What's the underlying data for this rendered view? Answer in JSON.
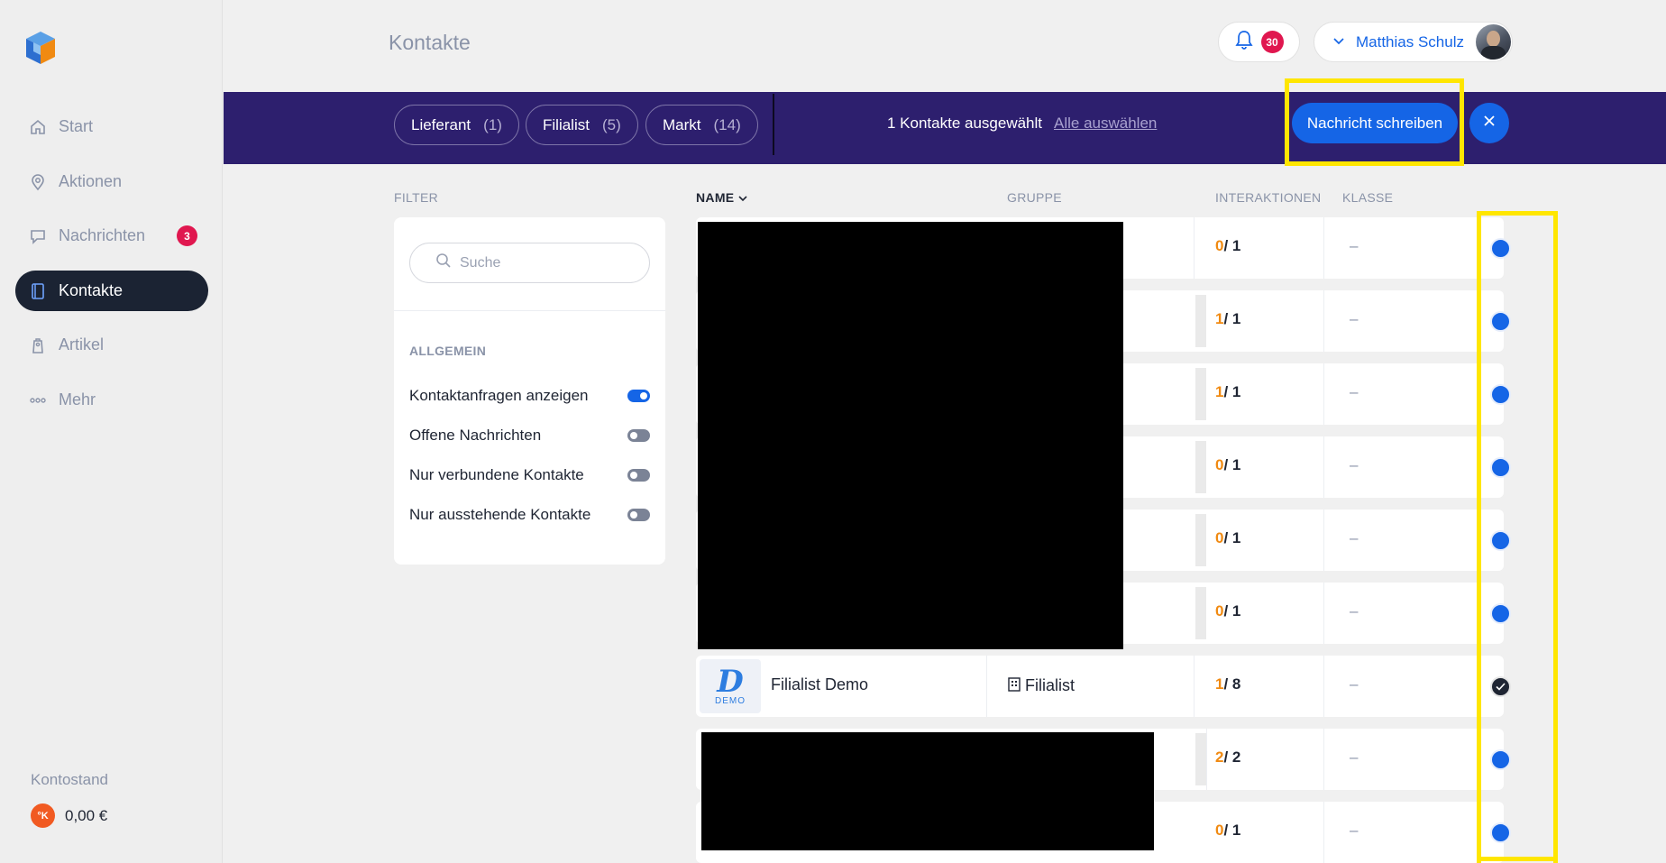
{
  "sidebar": {
    "items": [
      {
        "label": "Start",
        "icon": "home-icon"
      },
      {
        "label": "Aktionen",
        "icon": "location-icon"
      },
      {
        "label": "Nachrichten",
        "icon": "chat-icon",
        "badge": "3"
      },
      {
        "label": "Kontakte",
        "icon": "contacts-book-icon",
        "active": true
      },
      {
        "label": "Artikel",
        "icon": "tag-icon"
      },
      {
        "label": "Mehr",
        "icon": "more-dots-icon"
      }
    ],
    "konto_label": "Kontostand",
    "konto_coin": "°K",
    "konto_value": "0,00 €"
  },
  "header": {
    "title": "Kontakte",
    "notifications_count": "30",
    "user_name": "Matthias Schulz"
  },
  "action_bar": {
    "chips": [
      {
        "label": "Lieferant",
        "count": "(1)"
      },
      {
        "label": "Filialist",
        "count": "(5)"
      },
      {
        "label": "Markt",
        "count": "(14)"
      }
    ],
    "selection_text": "1 Kontakte ausgewählt",
    "select_all": "Alle auswählen",
    "send_message": "Nachricht schreiben"
  },
  "filter": {
    "label": "FILTER",
    "search_placeholder": "Suche",
    "section": "ALLGEMEIN",
    "toggles": [
      {
        "label": "Kontaktanfragen anzeigen",
        "on": true
      },
      {
        "label": "Offene Nachrichten",
        "on": false
      },
      {
        "label": "Nur verbundene Kontakte",
        "on": false
      },
      {
        "label": "Nur ausstehende Kontakte",
        "on": false
      }
    ]
  },
  "table": {
    "columns": {
      "name": "NAME",
      "group": "GRUPPE",
      "interactions": "INTERAKTIONEN",
      "class": "KLASSE"
    },
    "rows": [
      {
        "interactions_done": "0",
        "interactions_total": "/ 1",
        "class": "–",
        "selected": false
      },
      {
        "interactions_done": "1",
        "interactions_total": "/ 1",
        "class": "–",
        "selected": false
      },
      {
        "interactions_done": "1",
        "interactions_total": "/ 1",
        "class": "–",
        "selected": false
      },
      {
        "interactions_done": "0",
        "interactions_total": "/ 1",
        "class": "–",
        "selected": false
      },
      {
        "interactions_done": "0",
        "interactions_total": "/ 1",
        "class": "–",
        "selected": false
      },
      {
        "interactions_done": "0",
        "interactions_total": "/ 1",
        "class": "–",
        "selected": false
      },
      {
        "name": "Filialist Demo",
        "group": "Filialist",
        "logo_letter": "D",
        "logo_text": "DEMO",
        "interactions_done": "1",
        "interactions_total": "/ 8",
        "class": "–",
        "selected": true
      },
      {
        "interactions_done": "2",
        "interactions_total": "/ 2",
        "class": "–",
        "selected": false
      },
      {
        "interactions_done": "0",
        "interactions_total": "/ 1",
        "class": "–",
        "selected": false
      }
    ]
  },
  "colors": {
    "accent": "#1565e6",
    "bar": "#2d1f6e",
    "badge": "#e0174f",
    "highlight": "#ffe600",
    "interaction_count": "#f08a12"
  }
}
